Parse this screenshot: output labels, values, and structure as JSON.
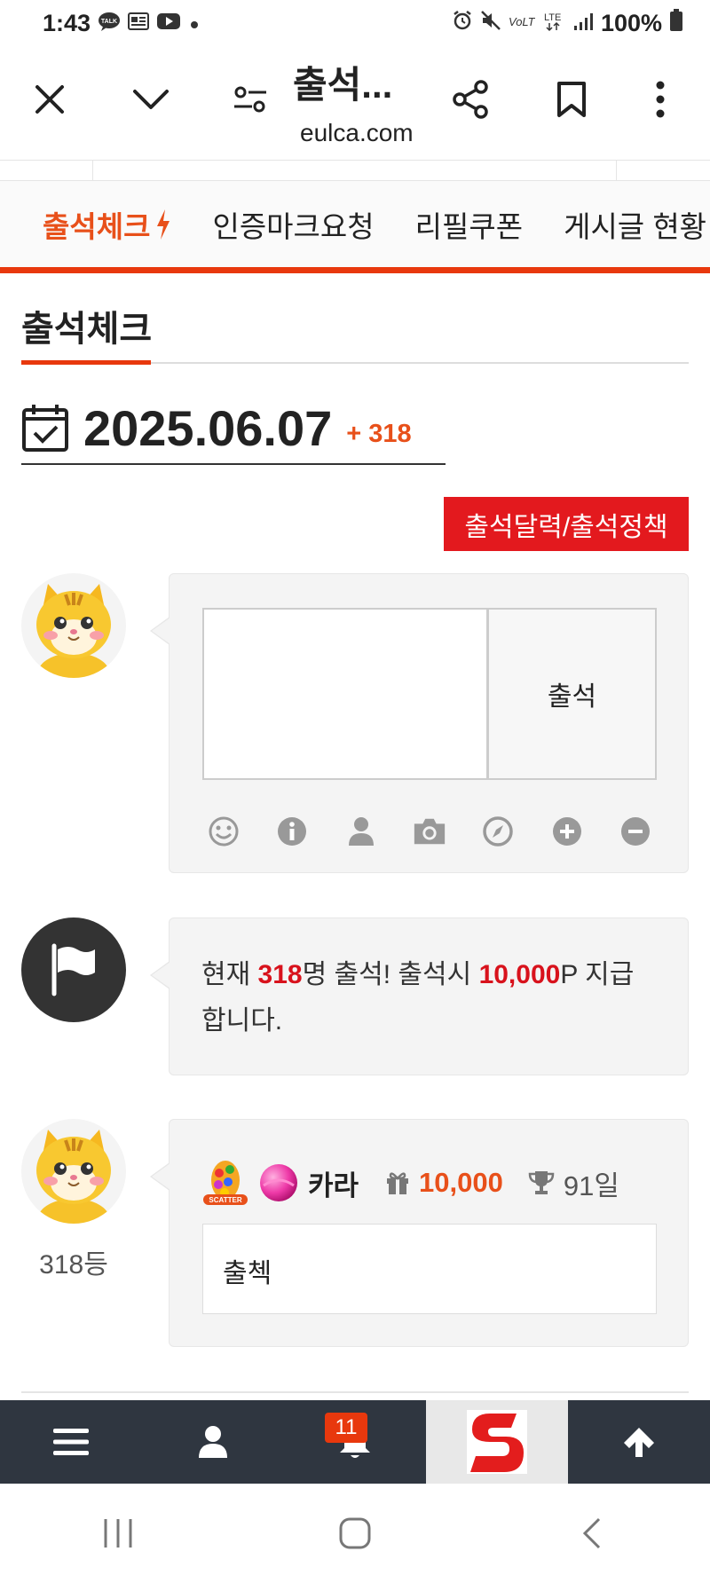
{
  "status_bar": {
    "time": "1:43",
    "battery": "100%",
    "network": "LTE"
  },
  "browser": {
    "title": "출석...",
    "domain": "eulca.com"
  },
  "tabs": [
    {
      "label": "출석체크",
      "active": true
    },
    {
      "label": "인증마크요청",
      "active": false
    },
    {
      "label": "리필쿠폰",
      "active": false
    },
    {
      "label": "게시글 현황",
      "active": false
    }
  ],
  "section": {
    "title": "출석체크",
    "date": "2025.06.07",
    "count": "+ 318",
    "policy_button": "출석달력/출석정책"
  },
  "compose": {
    "attend_button": "출석",
    "tools": [
      "smile-icon",
      "info-icon",
      "user-icon",
      "camera-icon",
      "compass-icon",
      "plus-circle-icon",
      "minus-circle-icon"
    ]
  },
  "notice": {
    "prefix": "현재 ",
    "count": "318",
    "middle": "명 출석! 출석시 ",
    "points": "10,000",
    "suffix": "P 지급합니다."
  },
  "entry": {
    "nickname": "카라",
    "points": "10,000",
    "days": "91일",
    "message": "출첵",
    "rank": "318등"
  },
  "bottom_bar": {
    "notification_count": "11"
  },
  "colors": {
    "accent": "#e8380d",
    "policy_button": "#e3191e",
    "highlight": "#d8121c",
    "bottom_bar": "#2f3640"
  }
}
